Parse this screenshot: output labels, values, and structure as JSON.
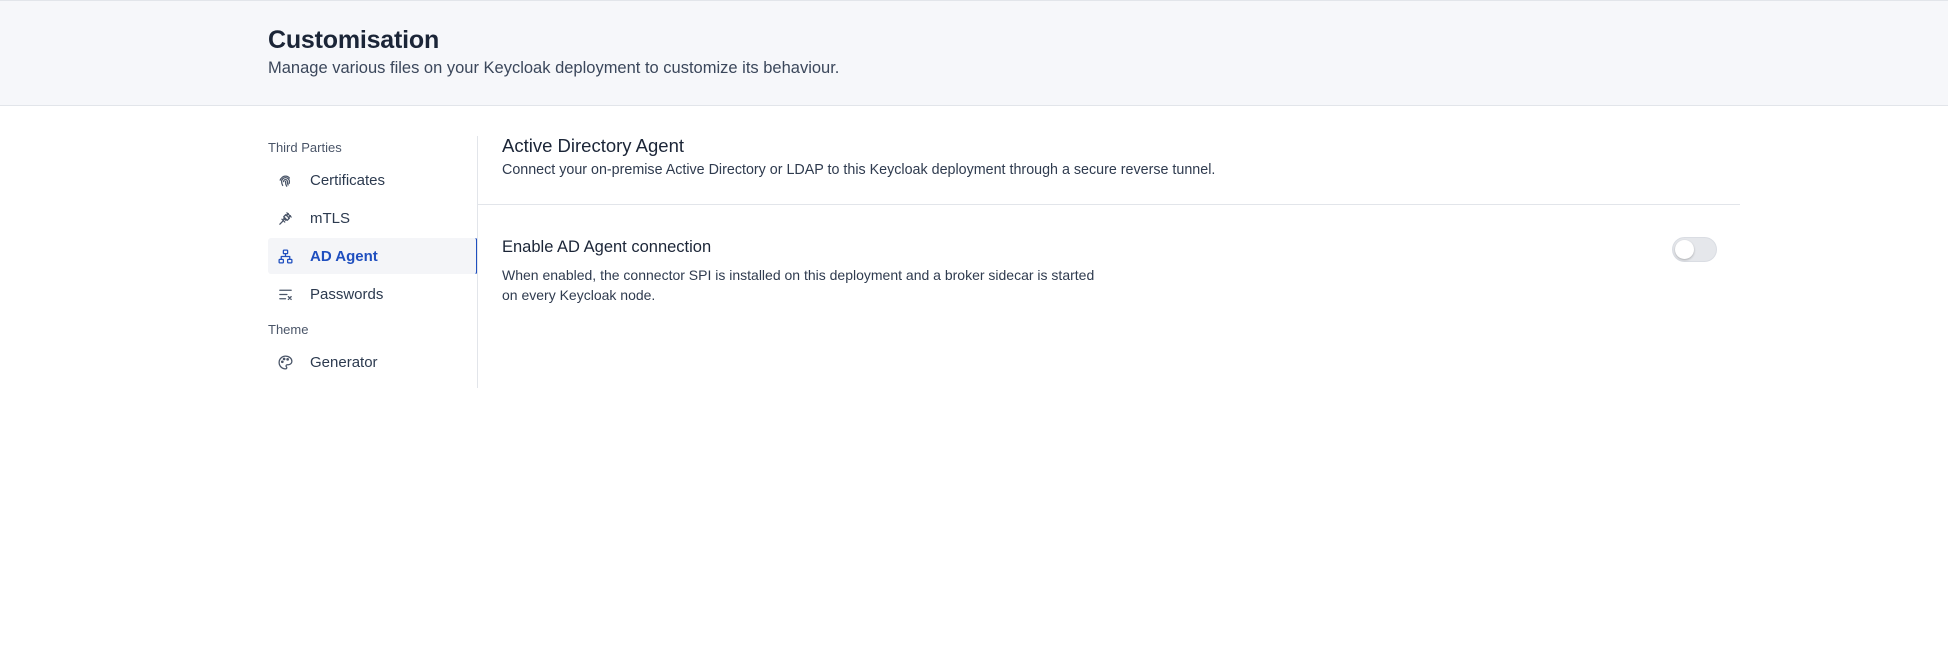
{
  "header": {
    "title": "Customisation",
    "subtitle": "Manage various files on your Keycloak deployment to customize its behaviour."
  },
  "sidebar": {
    "groups": [
      {
        "label": "Third Parties",
        "items": [
          {
            "label": "Certificates",
            "icon": "fingerprint-icon",
            "active": false
          },
          {
            "label": "mTLS",
            "icon": "plug-icon",
            "active": false
          },
          {
            "label": "AD Agent",
            "icon": "network-icon",
            "active": true
          },
          {
            "label": "Passwords",
            "icon": "text-clear-icon",
            "active": false
          }
        ]
      },
      {
        "label": "Theme",
        "items": [
          {
            "label": "Generator",
            "icon": "palette-icon",
            "active": false
          }
        ]
      }
    ]
  },
  "main": {
    "title": "Active Directory Agent",
    "description": "Connect your on-premise Active Directory or LDAP to this Keycloak deployment through a secure reverse tunnel.",
    "setting": {
      "title": "Enable AD Agent connection",
      "description": "When enabled, the connector SPI is installed on this deployment and a broker sidecar is started on every Keycloak node.",
      "enabled": false
    }
  },
  "colors": {
    "accent": "#1f4fbf",
    "header_bg": "#f6f7fa",
    "text": "#1b2537"
  }
}
